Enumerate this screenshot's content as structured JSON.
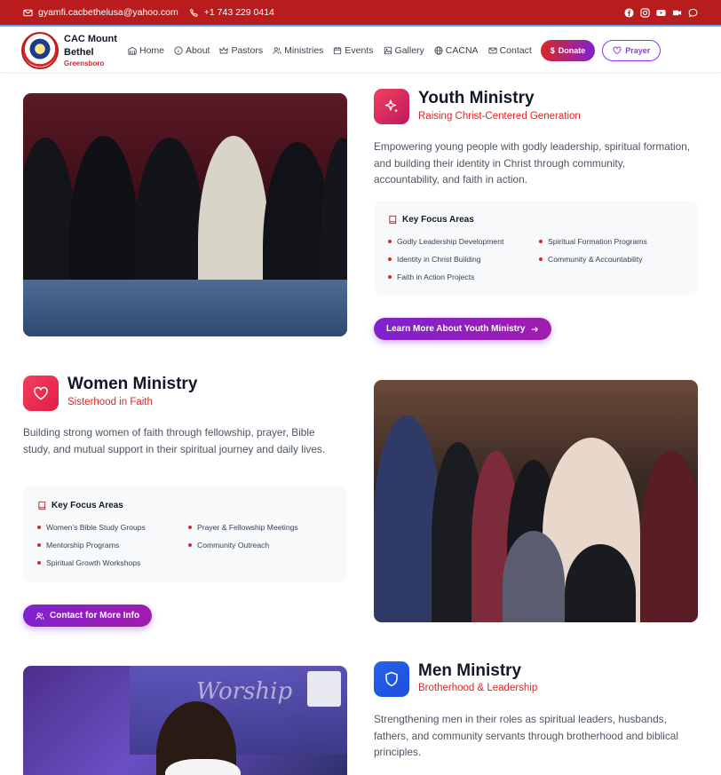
{
  "topbar": {
    "email": "gyamfi.cacbethelusa@yahoo.com",
    "phone": "+1 743 229 0414",
    "socials": [
      "facebook-icon",
      "instagram-icon",
      "youtube-icon",
      "video-icon",
      "chat-icon"
    ]
  },
  "nav": {
    "brand_name": "CAC Mount Bethel",
    "brand_city": "Greensboro",
    "items": [
      {
        "label": "Home",
        "icon": "building-icon"
      },
      {
        "label": "About",
        "icon": "info-icon"
      },
      {
        "label": "Pastors",
        "icon": "crown-icon"
      },
      {
        "label": "Ministries",
        "icon": "people-icon"
      },
      {
        "label": "Events",
        "icon": "calendar-icon"
      },
      {
        "label": "Gallery",
        "icon": "image-icon"
      },
      {
        "label": "CACNA",
        "icon": "globe-icon"
      },
      {
        "label": "Contact",
        "icon": "mail-icon"
      }
    ],
    "donate_label": "Donate",
    "prayer_label": "Prayer"
  },
  "youth": {
    "title": "Youth Ministry",
    "subtitle": "Raising Christ-Centered Generation",
    "description": "Empowering young people with godly leadership, spiritual formation, and building their identity in Christ through community, accountability, and faith in action.",
    "focus_heading": "Key Focus Areas",
    "focus_items": [
      "Godly Leadership Development",
      "Spiritual Formation Programs",
      "Identity in Christ Building",
      "Community & Accountability",
      "Faith in Action Projects"
    ],
    "cta_label": "Learn More About Youth Ministry"
  },
  "women": {
    "title": "Women Ministry",
    "subtitle": "Sisterhood in Faith",
    "description": "Building strong women of faith through fellowship, prayer, Bible study, and mutual support in their spiritual journey and daily lives.",
    "focus_heading": "Key Focus Areas",
    "focus_items": [
      "Women's Bible Study Groups",
      "Prayer & Fellowship Meetings",
      "Mentorship Programs",
      "Community Outreach",
      "Spiritual Growth Workshops"
    ],
    "cta_label": "Contact for More Info"
  },
  "men": {
    "title": "Men Ministry",
    "subtitle": "Brotherhood & Leadership",
    "description": "Strengthening men in their roles as spiritual leaders, husbands, fathers, and community servants through brotherhood and biblical principles.",
    "photo_text": "Worship"
  },
  "colors": {
    "brand_red": "#b91c1c",
    "accent_purple": "#7e22ce",
    "subtitle_red": "#dc2626"
  }
}
